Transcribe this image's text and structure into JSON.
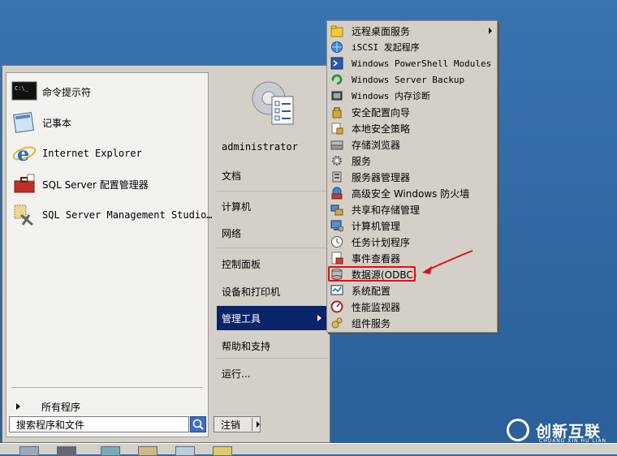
{
  "left_pane": {
    "pinned": [
      {
        "label": "命令提示符",
        "icon": "cmd-prompt-icon"
      },
      {
        "label": "记事本",
        "icon": "notepad-icon"
      },
      {
        "label": "Internet Explorer",
        "icon": "internet-explorer-icon"
      },
      {
        "label": "SQL Server 配置管理器",
        "icon": "sql-config-manager-icon"
      },
      {
        "label": "SQL Server Management Studio…",
        "icon": "sql-management-studio-icon"
      }
    ],
    "all_programs": "所有程序",
    "search_placeholder": "搜索程序和文件"
  },
  "right_pane": {
    "user": "administrator",
    "items": [
      {
        "label": "文档"
      },
      {
        "label": "计算机"
      },
      {
        "label": "网络"
      },
      {
        "label": "控制面板"
      },
      {
        "label": "设备和打印机"
      },
      {
        "label": "管理工具",
        "active": true
      },
      {
        "label": "帮助和支持"
      },
      {
        "label": "运行..."
      }
    ],
    "logout": "注销"
  },
  "submenu": {
    "items": [
      {
        "label": "远程桌面服务",
        "icon": "folder-icon",
        "has_submenu": true
      },
      {
        "label": "iSCSI 发起程序",
        "icon": "iscsi-globe-icon"
      },
      {
        "label": "Windows PowerShell Modules",
        "icon": "powershell-icon"
      },
      {
        "label": "Windows Server Backup",
        "icon": "backup-icon"
      },
      {
        "label": "Windows 内存诊断",
        "icon": "memory-diagnostic-icon"
      },
      {
        "label": "安全配置向导",
        "icon": "security-wizard-icon"
      },
      {
        "label": "本地安全策略",
        "icon": "local-security-policy-icon"
      },
      {
        "label": "存储浏览器",
        "icon": "storage-explorer-icon"
      },
      {
        "label": "服务",
        "icon": "services-gear-icon"
      },
      {
        "label": "服务器管理器",
        "icon": "server-manager-icon"
      },
      {
        "label": "高级安全 Windows 防火墙",
        "icon": "firewall-icon"
      },
      {
        "label": "共享和存储管理",
        "icon": "share-storage-icon"
      },
      {
        "label": "计算机管理",
        "icon": "computer-management-icon"
      },
      {
        "label": "任务计划程序",
        "icon": "task-scheduler-clock-icon"
      },
      {
        "label": "事件查看器",
        "icon": "event-viewer-icon"
      },
      {
        "label": "数据源(ODBC)",
        "icon": "odbc-data-source-icon",
        "highlighted": true
      },
      {
        "label": "系统配置",
        "icon": "system-config-icon"
      },
      {
        "label": "性能监视器",
        "icon": "performance-monitor-icon"
      },
      {
        "label": "组件服务",
        "icon": "component-services-icon"
      }
    ]
  },
  "watermark": {
    "name": "创新互联",
    "sub": "CHUANG XIN HU LIAN"
  },
  "colors": {
    "accent": "#0a246a",
    "annotation": "#e01010",
    "desktop": "#2f6aa8"
  }
}
